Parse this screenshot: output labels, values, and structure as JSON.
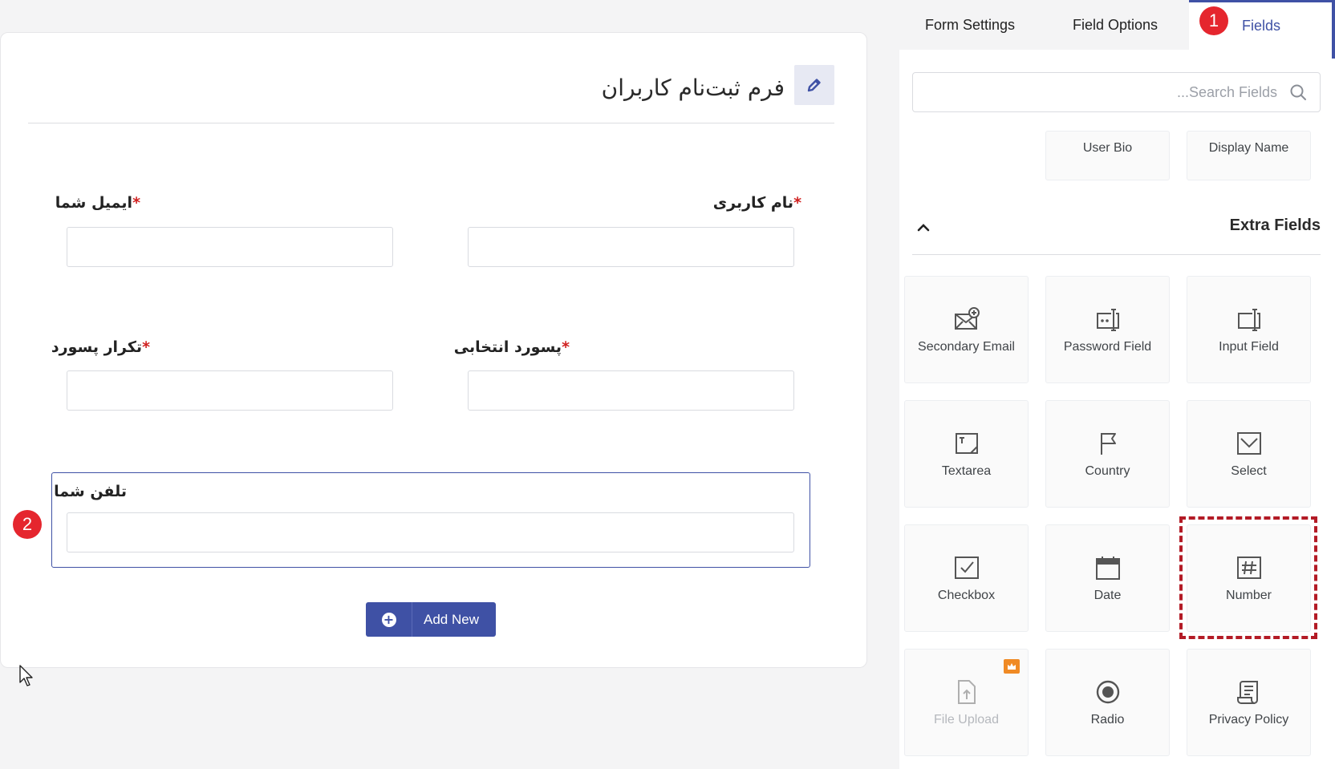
{
  "form": {
    "title": "فرم ثبت‌نام کاربران",
    "fields": [
      {
        "label": "نام کاربری",
        "required": "*"
      },
      {
        "label": "ایمیل شما",
        "required": "*"
      },
      {
        "label": "پسورد انتخابی",
        "required": "*"
      },
      {
        "label": "تکرار پسورد",
        "required": "*"
      },
      {
        "label": "تلفن شما"
      }
    ],
    "add_new_label": "Add New"
  },
  "badges": {
    "one": "1",
    "two": "2"
  },
  "panel": {
    "tabs": [
      {
        "label": "Form Settings"
      },
      {
        "label": "Field Options"
      },
      {
        "label": "Fields"
      }
    ],
    "search_placeholder": "...Search Fields",
    "top_tiles": [
      {
        "label": "User Bio"
      },
      {
        "label": "Display Name"
      }
    ],
    "section_title": "Extra Fields",
    "tiles": [
      {
        "label": "Secondary Email",
        "icon": "envelope-plus-icon"
      },
      {
        "label": "Password Field",
        "icon": "password-field-icon"
      },
      {
        "label": "Input Field",
        "icon": "input-field-icon"
      },
      {
        "label": "Textarea",
        "icon": "textarea-icon"
      },
      {
        "label": "Country",
        "icon": "flag-icon"
      },
      {
        "label": "Select",
        "icon": "select-check-icon"
      },
      {
        "label": "Checkbox",
        "icon": "checkbox-icon"
      },
      {
        "label": "Date",
        "icon": "calendar-icon"
      },
      {
        "label": "Number",
        "icon": "hash-icon"
      },
      {
        "label": "File Upload",
        "icon": "file-upload-icon"
      },
      {
        "label": "Radio",
        "icon": "radio-icon"
      },
      {
        "label": "Privacy Policy",
        "icon": "scroll-icon"
      }
    ]
  },
  "colors": {
    "accent": "#3f51a5",
    "badge": "#e5262e",
    "highlight": "#b31b26",
    "required": "#d0201f",
    "premium": "#f08a24"
  }
}
